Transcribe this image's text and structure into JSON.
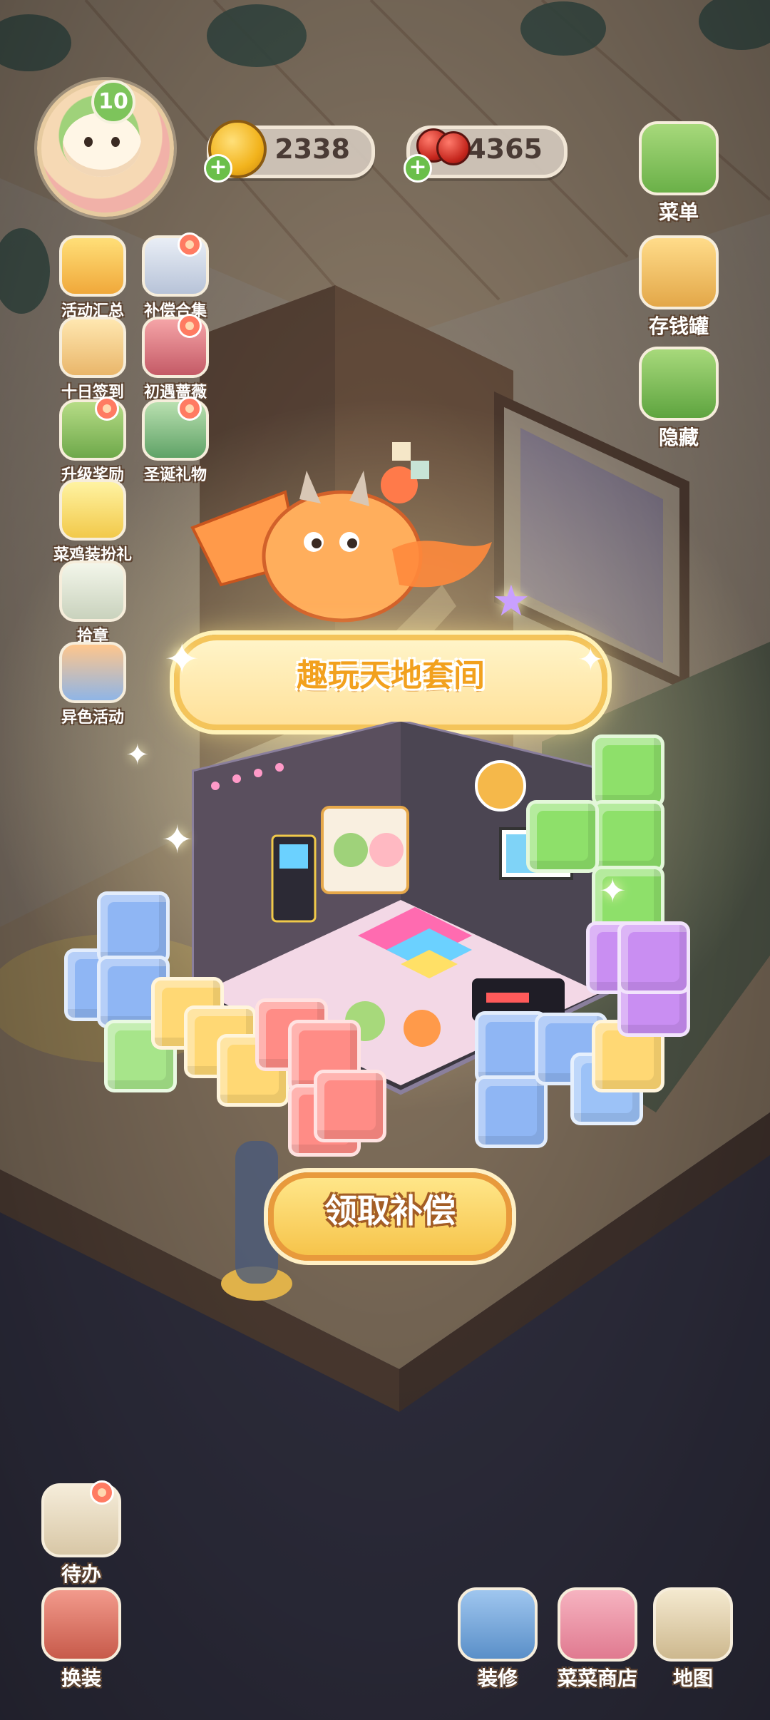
{
  "hud": {
    "level": "10",
    "coins": "2338",
    "cherries": "4365"
  },
  "left_buttons": [
    {
      "label": "活动汇总",
      "icon": "event-summary-icon"
    },
    {
      "label": "补偿合集",
      "icon": "compensation-collection-icon"
    },
    {
      "label": "十日签到",
      "icon": "ten-day-checkin-icon"
    },
    {
      "label": "初遇蔷薇",
      "icon": "first-rose-icon"
    },
    {
      "label": "升级奖励",
      "icon": "level-reward-icon"
    },
    {
      "label": "圣诞礼物",
      "icon": "christmas-gift-icon"
    },
    {
      "label": "菜鸡装扮礼",
      "icon": "chick-outfit-gift-icon"
    },
    {
      "label": "拾章",
      "icon": "badge-icon"
    },
    {
      "label": "异色活动",
      "icon": "variant-event-icon"
    }
  ],
  "right_buttons": [
    {
      "label": "菜单",
      "icon": "menu-icon"
    },
    {
      "label": "存钱罐",
      "icon": "piggy-bank-icon"
    },
    {
      "label": "隐藏",
      "icon": "hide-icon"
    }
  ],
  "bottom_left_buttons": [
    {
      "label": "待办",
      "icon": "todo-icon"
    },
    {
      "label": "换装",
      "icon": "outfit-icon"
    }
  ],
  "bottom_right_buttons": [
    {
      "label": "装修",
      "icon": "decorate-icon"
    },
    {
      "label": "菜菜商店",
      "icon": "shop-icon"
    },
    {
      "label": "地图",
      "icon": "map-icon"
    }
  ],
  "popup": {
    "title": "趣玩天地套间",
    "claim_button": "领取补偿"
  },
  "colors": {
    "accent_yellow": "#f6c44b",
    "title_orange": "#f2a11e",
    "badge_red": "#ff7b62",
    "level_green": "#7dc45b"
  }
}
